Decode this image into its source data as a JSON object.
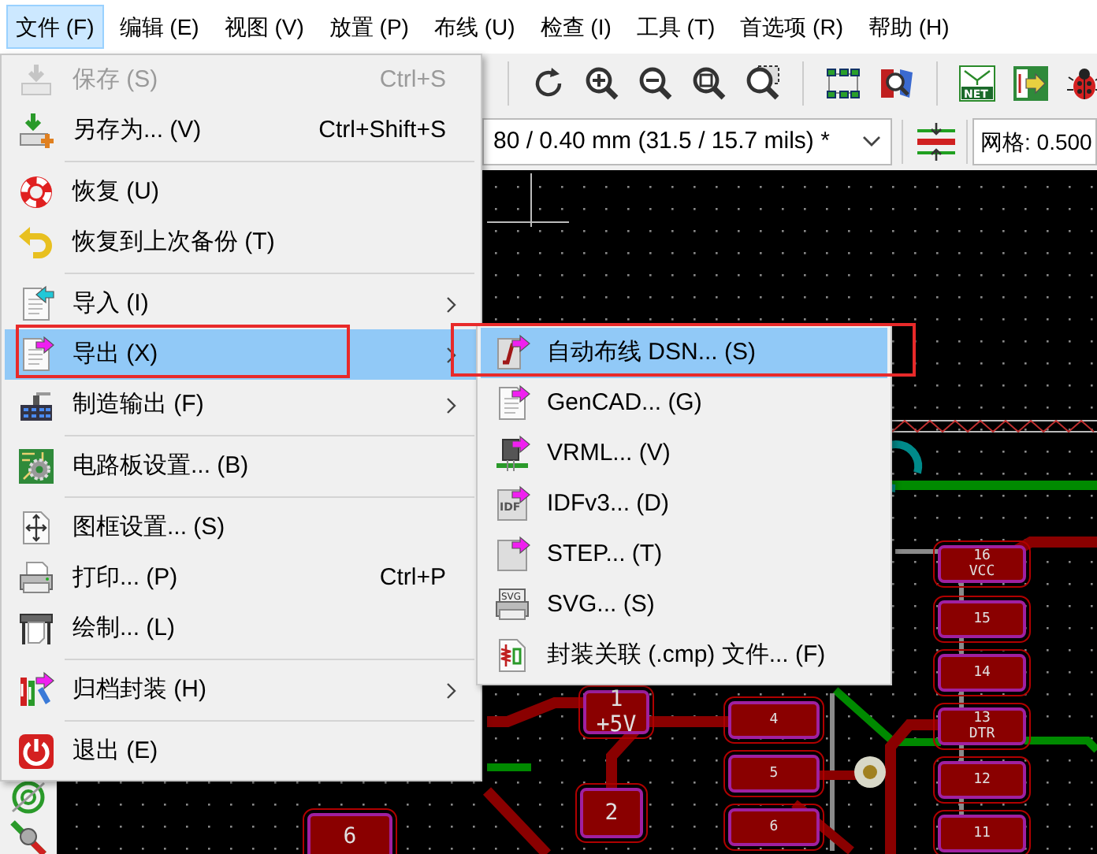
{
  "menubar": [
    {
      "label": "文件 (F)",
      "selected": true
    },
    {
      "label": "编辑 (E)",
      "selected": false
    },
    {
      "label": "视图 (V)",
      "selected": false
    },
    {
      "label": "放置 (P)",
      "selected": false
    },
    {
      "label": "布线 (U)",
      "selected": false
    },
    {
      "label": "检查 (I)",
      "selected": false
    },
    {
      "label": "工具 (T)",
      "selected": false
    },
    {
      "label": "首选项 (R)",
      "selected": false
    },
    {
      "label": "帮助 (H)",
      "selected": false
    }
  ],
  "toolbar": {
    "net_label": "NET"
  },
  "track_width": {
    "value": "80 / 0.40 mm (31.5 / 15.7 mils) *"
  },
  "grid": {
    "value": "网格: 0.500"
  },
  "file_menu": [
    {
      "kind": "item",
      "label": "保存 (S)",
      "shortcut": "Ctrl+S",
      "disabled": true,
      "selected": false,
      "submenu": false,
      "framed": false
    },
    {
      "kind": "item",
      "label": "另存为... (V)",
      "shortcut": "Ctrl+Shift+S",
      "disabled": false,
      "selected": false,
      "submenu": false,
      "framed": false
    },
    {
      "kind": "separator"
    },
    {
      "kind": "item",
      "label": "恢复 (U)",
      "disabled": false,
      "selected": false,
      "submenu": false,
      "framed": false
    },
    {
      "kind": "item",
      "label": "恢复到上次备份 (T)",
      "disabled": false,
      "selected": false,
      "submenu": false,
      "framed": false
    },
    {
      "kind": "separator"
    },
    {
      "kind": "item",
      "label": "导入 (I)",
      "disabled": false,
      "selected": false,
      "submenu": true,
      "framed": false
    },
    {
      "kind": "item",
      "label": "导出 (X)",
      "disabled": false,
      "selected": true,
      "submenu": true,
      "framed": true
    },
    {
      "kind": "item",
      "label": "制造输出 (F)",
      "disabled": false,
      "selected": false,
      "submenu": true,
      "framed": false
    },
    {
      "kind": "separator"
    },
    {
      "kind": "item",
      "label": "电路板设置... (B)",
      "disabled": false,
      "selected": false,
      "submenu": false,
      "framed": false
    },
    {
      "kind": "separator"
    },
    {
      "kind": "item",
      "label": "图框设置... (S)",
      "disabled": false,
      "selected": false,
      "submenu": false,
      "framed": false
    },
    {
      "kind": "item",
      "label": "打印... (P)",
      "shortcut": "Ctrl+P",
      "disabled": false,
      "selected": false,
      "submenu": false,
      "framed": false
    },
    {
      "kind": "item",
      "label": "绘制... (L)",
      "disabled": false,
      "selected": false,
      "submenu": false,
      "framed": false
    },
    {
      "kind": "separator"
    },
    {
      "kind": "item",
      "label": "归档封装 (H)",
      "disabled": false,
      "selected": false,
      "submenu": true,
      "framed": false
    },
    {
      "kind": "separator"
    },
    {
      "kind": "item",
      "label": "退出 (E)",
      "disabled": false,
      "selected": false,
      "submenu": false,
      "framed": false
    }
  ],
  "export_submenu": [
    {
      "label": "自动布线 DSN... (S)",
      "selected": true,
      "framed": true
    },
    {
      "label": "GenCAD... (G)",
      "selected": false,
      "framed": false
    },
    {
      "label": "VRML... (V)",
      "selected": false,
      "framed": false
    },
    {
      "label": "IDFv3... (D)",
      "selected": false,
      "framed": false,
      "icon_text": "IDF"
    },
    {
      "label": "STEP... (T)",
      "selected": false,
      "framed": false
    },
    {
      "label": "SVG... (S)",
      "selected": false,
      "framed": false,
      "icon_text": "SVG"
    },
    {
      "label": "封装关联 (.cmp) 文件... (F)",
      "selected": false,
      "framed": false
    }
  ],
  "pcb": {
    "pads": [
      {
        "number": "16",
        "net": "VCC"
      },
      {
        "number": "15"
      },
      {
        "number": "14"
      },
      {
        "number": "13",
        "net": "DTR"
      },
      {
        "number": "12"
      },
      {
        "number": "11"
      },
      {
        "number": "4"
      },
      {
        "number": "5"
      },
      {
        "number": "6"
      },
      {
        "number": "1",
        "net": "+5V"
      },
      {
        "number": "2"
      },
      {
        "number": "6"
      }
    ]
  }
}
